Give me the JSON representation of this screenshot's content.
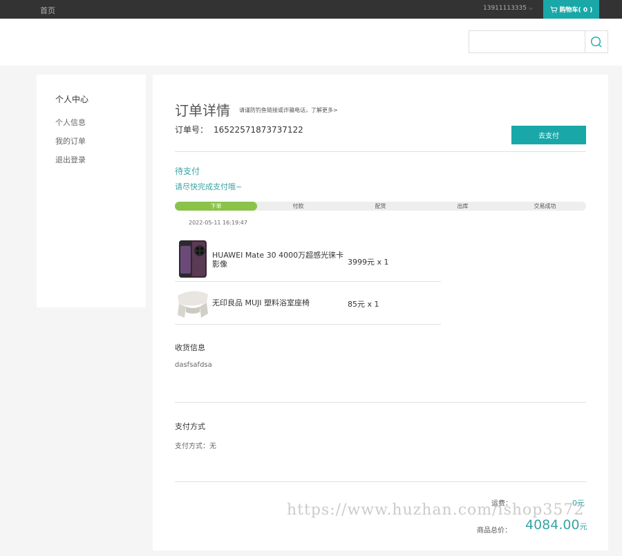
{
  "topbar": {
    "home": "首页",
    "user": "13911113335",
    "cart": "购物车( 0 )"
  },
  "header": {
    "search_placeholder": ""
  },
  "sidebar": {
    "title": "个人中心",
    "items": [
      "个人信息",
      "我的订单",
      "退出登录"
    ]
  },
  "order": {
    "title": "订单详情",
    "note": "请谨防钓鱼链接或诈骗电话，了解更多>",
    "order_no_label": "订单号：",
    "order_no": "16522571873737122",
    "pay_button": "去支付",
    "status": "待支付",
    "status_hint": "请尽快完成支付哦~",
    "progress": {
      "steps": [
        "下单",
        "付款",
        "配货",
        "出库",
        "交易成功"
      ],
      "current": 1,
      "time": "2022-05-11 16:19:47"
    },
    "goods": [
      {
        "name": "HUAWEI Mate 30 4000万超感光徕卡影像",
        "price": "3999元 x 1",
        "icon": "phone-image"
      },
      {
        "name": "无印良品 MUJI 塑料浴室座椅",
        "price": "85元 x 1",
        "icon": "stool-image"
      }
    ],
    "shipping": {
      "title": "收货信息",
      "text": "dasfsafdsa"
    },
    "payment": {
      "title": "支付方式",
      "text": "支付方式：无"
    },
    "totals": {
      "shipping_label": "运费：",
      "shipping_value": "0元",
      "total_label": "商品总价：",
      "total_value": "4084.00",
      "total_unit": "元"
    }
  },
  "watermark": "https://www.huzhan.com/ishop3572",
  "colors": {
    "accent": "#1aa7a7",
    "progress": "#8bc34a",
    "topbar": "#333333"
  }
}
